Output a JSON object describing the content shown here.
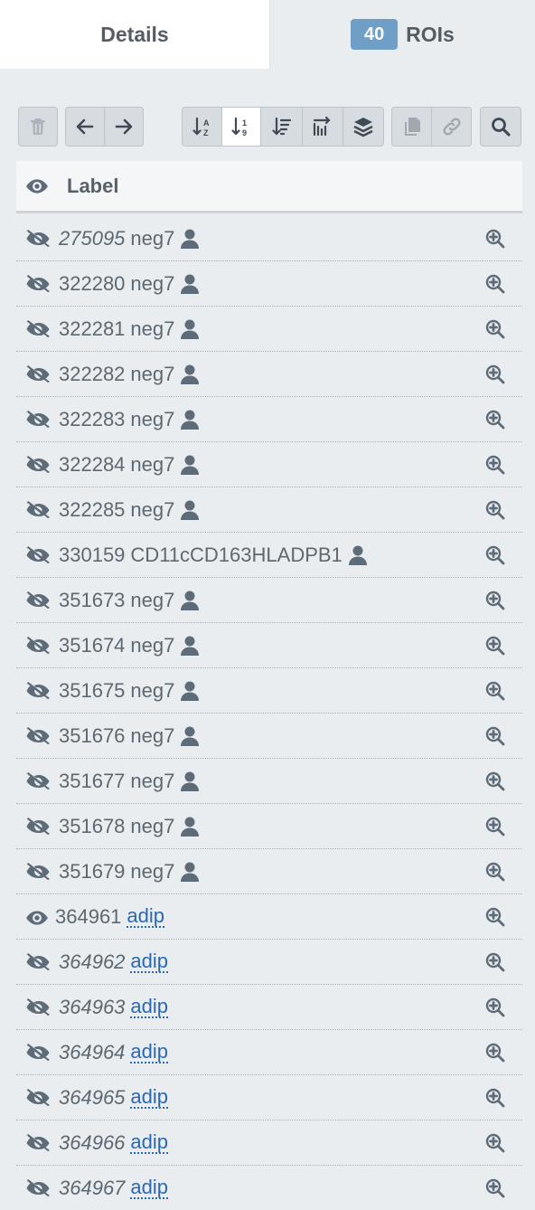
{
  "tabs": {
    "details_label": "Details",
    "rois_count": "40",
    "rois_label": "ROIs"
  },
  "toolbar": {
    "icons": [
      "trash-icon",
      "arrow-left-icon",
      "arrow-right-icon",
      "sort-alpha-asc-icon",
      "sort-numeric-asc-icon",
      "sort-amount-desc-icon",
      "sort-custom-icon",
      "layers-icon",
      "copy-icon",
      "link-icon",
      "search-icon"
    ]
  },
  "header": {
    "label": "Label"
  },
  "rows": [
    {
      "id": "275095",
      "category": "neg7",
      "italic": true,
      "visible": false,
      "link": false
    },
    {
      "id": "322280",
      "category": "neg7",
      "italic": false,
      "visible": false,
      "link": false
    },
    {
      "id": "322281",
      "category": "neg7",
      "italic": false,
      "visible": false,
      "link": false
    },
    {
      "id": "322282",
      "category": "neg7",
      "italic": false,
      "visible": false,
      "link": false
    },
    {
      "id": "322283",
      "category": "neg7",
      "italic": false,
      "visible": false,
      "link": false
    },
    {
      "id": "322284",
      "category": "neg7",
      "italic": false,
      "visible": false,
      "link": false
    },
    {
      "id": "322285",
      "category": "neg7",
      "italic": false,
      "visible": false,
      "link": false
    },
    {
      "id": "330159",
      "category": "CD11cCD163HLADPB1",
      "italic": false,
      "visible": false,
      "link": false
    },
    {
      "id": "351673",
      "category": "neg7",
      "italic": false,
      "visible": false,
      "link": false
    },
    {
      "id": "351674",
      "category": "neg7",
      "italic": false,
      "visible": false,
      "link": false
    },
    {
      "id": "351675",
      "category": "neg7",
      "italic": false,
      "visible": false,
      "link": false
    },
    {
      "id": "351676",
      "category": "neg7",
      "italic": false,
      "visible": false,
      "link": false
    },
    {
      "id": "351677",
      "category": "neg7",
      "italic": false,
      "visible": false,
      "link": false
    },
    {
      "id": "351678",
      "category": "neg7",
      "italic": false,
      "visible": false,
      "link": false
    },
    {
      "id": "351679",
      "category": "neg7",
      "italic": false,
      "visible": false,
      "link": false
    },
    {
      "id": "364961",
      "category": "adip",
      "italic": false,
      "visible": true,
      "link": true
    },
    {
      "id": "364962",
      "category": "adip",
      "italic": true,
      "visible": false,
      "link": true
    },
    {
      "id": "364963",
      "category": "adip",
      "italic": true,
      "visible": false,
      "link": true
    },
    {
      "id": "364964",
      "category": "adip",
      "italic": true,
      "visible": false,
      "link": true
    },
    {
      "id": "364965",
      "category": "adip",
      "italic": true,
      "visible": false,
      "link": true
    },
    {
      "id": "364966",
      "category": "adip",
      "italic": true,
      "visible": false,
      "link": true
    },
    {
      "id": "364967",
      "category": "adip",
      "italic": true,
      "visible": false,
      "link": true
    }
  ],
  "colors": {
    "accent": "#6f9ec7",
    "link": "#2a68b0",
    "icon": "#5e6b78"
  }
}
